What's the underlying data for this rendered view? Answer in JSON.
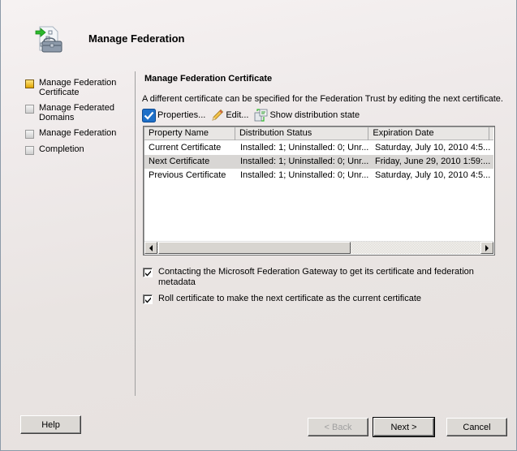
{
  "header": {
    "title": "Manage Federation",
    "icon": "federation-toolbox-icon"
  },
  "steps": [
    {
      "label": "Manage Federation Certificate",
      "state": "active"
    },
    {
      "label": "Manage Federated Domains",
      "state": "pending"
    },
    {
      "label": "Manage Federation",
      "state": "pending"
    },
    {
      "label": "Completion",
      "state": "pending"
    }
  ],
  "section": {
    "title": "Manage Federation Certificate",
    "description": "A different certificate can be specified for the Federation Trust by editing the next certificate."
  },
  "toolbar": {
    "properties_label": "Properties...",
    "edit_label": "Edit...",
    "show_distribution_label": "Show distribution state"
  },
  "grid": {
    "columns": [
      "Property Name",
      "Distribution Status",
      "Expiration Date",
      ""
    ],
    "rows": [
      {
        "name": "Current Certificate",
        "status": "Installed: 1; Uninstalled: 0; Unr...",
        "expiration": "Saturday, July 10, 2010 4:5...",
        "selected": false
      },
      {
        "name": "Next Certificate",
        "status": "Installed: 1; Uninstalled: 0; Unr...",
        "expiration": "Friday, June 29, 2010 1:59:...",
        "selected": true
      },
      {
        "name": "Previous Certificate",
        "status": "Installed: 1; Uninstalled: 0; Unr...",
        "expiration": "Saturday, July 10, 2010 4:5...",
        "selected": false
      }
    ],
    "hscroll_fraction_visible": 0.57
  },
  "options": [
    {
      "label": "Contacting the Microsoft Federation Gateway to get its certificate and federation metadata",
      "checked": true
    },
    {
      "label": "Roll certificate to make the next certificate as the current certificate",
      "checked": true
    }
  ],
  "buttons": {
    "help": "Help",
    "back": "< Back",
    "next": "Next >",
    "cancel": "Cancel"
  },
  "colors": {
    "active_step": "#e0a400",
    "selected_row": "#d8d6d4",
    "properties_icon": "#1e6fc8",
    "arrow_green": "#2cb82c"
  }
}
